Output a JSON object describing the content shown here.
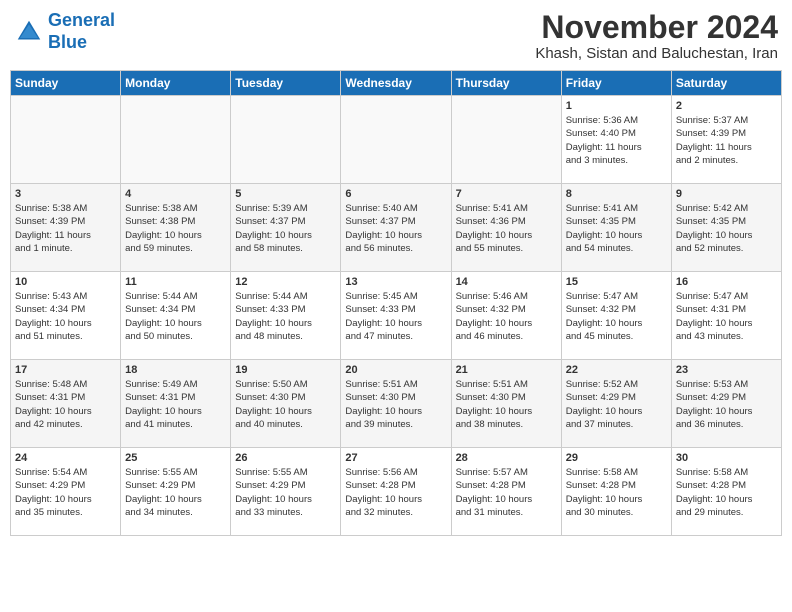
{
  "header": {
    "logo_line1": "General",
    "logo_line2": "Blue",
    "month": "November 2024",
    "location": "Khash, Sistan and Baluchestan, Iran"
  },
  "days_of_week": [
    "Sunday",
    "Monday",
    "Tuesday",
    "Wednesday",
    "Thursday",
    "Friday",
    "Saturday"
  ],
  "weeks": [
    [
      {
        "num": "",
        "info": ""
      },
      {
        "num": "",
        "info": ""
      },
      {
        "num": "",
        "info": ""
      },
      {
        "num": "",
        "info": ""
      },
      {
        "num": "",
        "info": ""
      },
      {
        "num": "1",
        "info": "Sunrise: 5:36 AM\nSunset: 4:40 PM\nDaylight: 11 hours\nand 3 minutes."
      },
      {
        "num": "2",
        "info": "Sunrise: 5:37 AM\nSunset: 4:39 PM\nDaylight: 11 hours\nand 2 minutes."
      }
    ],
    [
      {
        "num": "3",
        "info": "Sunrise: 5:38 AM\nSunset: 4:39 PM\nDaylight: 11 hours\nand 1 minute."
      },
      {
        "num": "4",
        "info": "Sunrise: 5:38 AM\nSunset: 4:38 PM\nDaylight: 10 hours\nand 59 minutes."
      },
      {
        "num": "5",
        "info": "Sunrise: 5:39 AM\nSunset: 4:37 PM\nDaylight: 10 hours\nand 58 minutes."
      },
      {
        "num": "6",
        "info": "Sunrise: 5:40 AM\nSunset: 4:37 PM\nDaylight: 10 hours\nand 56 minutes."
      },
      {
        "num": "7",
        "info": "Sunrise: 5:41 AM\nSunset: 4:36 PM\nDaylight: 10 hours\nand 55 minutes."
      },
      {
        "num": "8",
        "info": "Sunrise: 5:41 AM\nSunset: 4:35 PM\nDaylight: 10 hours\nand 54 minutes."
      },
      {
        "num": "9",
        "info": "Sunrise: 5:42 AM\nSunset: 4:35 PM\nDaylight: 10 hours\nand 52 minutes."
      }
    ],
    [
      {
        "num": "10",
        "info": "Sunrise: 5:43 AM\nSunset: 4:34 PM\nDaylight: 10 hours\nand 51 minutes."
      },
      {
        "num": "11",
        "info": "Sunrise: 5:44 AM\nSunset: 4:34 PM\nDaylight: 10 hours\nand 50 minutes."
      },
      {
        "num": "12",
        "info": "Sunrise: 5:44 AM\nSunset: 4:33 PM\nDaylight: 10 hours\nand 48 minutes."
      },
      {
        "num": "13",
        "info": "Sunrise: 5:45 AM\nSunset: 4:33 PM\nDaylight: 10 hours\nand 47 minutes."
      },
      {
        "num": "14",
        "info": "Sunrise: 5:46 AM\nSunset: 4:32 PM\nDaylight: 10 hours\nand 46 minutes."
      },
      {
        "num": "15",
        "info": "Sunrise: 5:47 AM\nSunset: 4:32 PM\nDaylight: 10 hours\nand 45 minutes."
      },
      {
        "num": "16",
        "info": "Sunrise: 5:47 AM\nSunset: 4:31 PM\nDaylight: 10 hours\nand 43 minutes."
      }
    ],
    [
      {
        "num": "17",
        "info": "Sunrise: 5:48 AM\nSunset: 4:31 PM\nDaylight: 10 hours\nand 42 minutes."
      },
      {
        "num": "18",
        "info": "Sunrise: 5:49 AM\nSunset: 4:31 PM\nDaylight: 10 hours\nand 41 minutes."
      },
      {
        "num": "19",
        "info": "Sunrise: 5:50 AM\nSunset: 4:30 PM\nDaylight: 10 hours\nand 40 minutes."
      },
      {
        "num": "20",
        "info": "Sunrise: 5:51 AM\nSunset: 4:30 PM\nDaylight: 10 hours\nand 39 minutes."
      },
      {
        "num": "21",
        "info": "Sunrise: 5:51 AM\nSunset: 4:30 PM\nDaylight: 10 hours\nand 38 minutes."
      },
      {
        "num": "22",
        "info": "Sunrise: 5:52 AM\nSunset: 4:29 PM\nDaylight: 10 hours\nand 37 minutes."
      },
      {
        "num": "23",
        "info": "Sunrise: 5:53 AM\nSunset: 4:29 PM\nDaylight: 10 hours\nand 36 minutes."
      }
    ],
    [
      {
        "num": "24",
        "info": "Sunrise: 5:54 AM\nSunset: 4:29 PM\nDaylight: 10 hours\nand 35 minutes."
      },
      {
        "num": "25",
        "info": "Sunrise: 5:55 AM\nSunset: 4:29 PM\nDaylight: 10 hours\nand 34 minutes."
      },
      {
        "num": "26",
        "info": "Sunrise: 5:55 AM\nSunset: 4:29 PM\nDaylight: 10 hours\nand 33 minutes."
      },
      {
        "num": "27",
        "info": "Sunrise: 5:56 AM\nSunset: 4:28 PM\nDaylight: 10 hours\nand 32 minutes."
      },
      {
        "num": "28",
        "info": "Sunrise: 5:57 AM\nSunset: 4:28 PM\nDaylight: 10 hours\nand 31 minutes."
      },
      {
        "num": "29",
        "info": "Sunrise: 5:58 AM\nSunset: 4:28 PM\nDaylight: 10 hours\nand 30 minutes."
      },
      {
        "num": "30",
        "info": "Sunrise: 5:58 AM\nSunset: 4:28 PM\nDaylight: 10 hours\nand 29 minutes."
      }
    ]
  ]
}
